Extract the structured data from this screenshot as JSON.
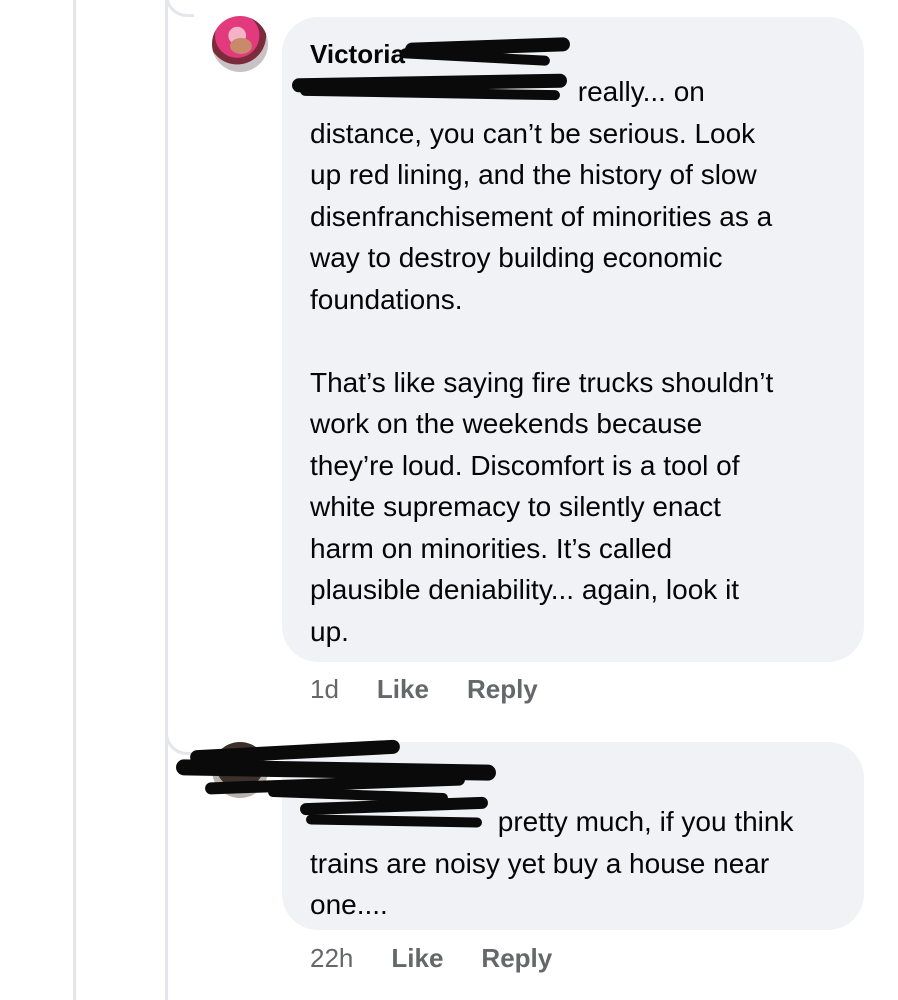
{
  "comments": [
    {
      "author": "Victoria",
      "mention": "",
      "first_line": " really... on",
      "paragraph_1": "distance, you can’t be serious. Look\nup red lining, and the history of slow\ndisenfranchisement of minorities as a\nway to destroy building economic\nfoundations.",
      "paragraph_2": "That’s like saying fire trucks shouldn’t\nwork on the weekends because\nthey’re loud. Discomfort is a tool of\nwhite supremacy to silently enact\nharm on minorities. It’s called\nplausible deniability... again, look it\nup.",
      "time": "1d",
      "like_label": "Like",
      "reply_label": "Reply"
    },
    {
      "author": "",
      "mention": "",
      "first_line": " pretty much, if you think",
      "paragraph_1": "trains are noisy yet buy a house near\none....",
      "time": "22h",
      "like_label": "Like",
      "reply_label": "Reply"
    }
  ],
  "colors": {
    "bubble": "#f0f2f5",
    "text": "#050505",
    "meta": "#65676b",
    "mention": "#216fdb",
    "thread_line": "#e4e6eb"
  }
}
